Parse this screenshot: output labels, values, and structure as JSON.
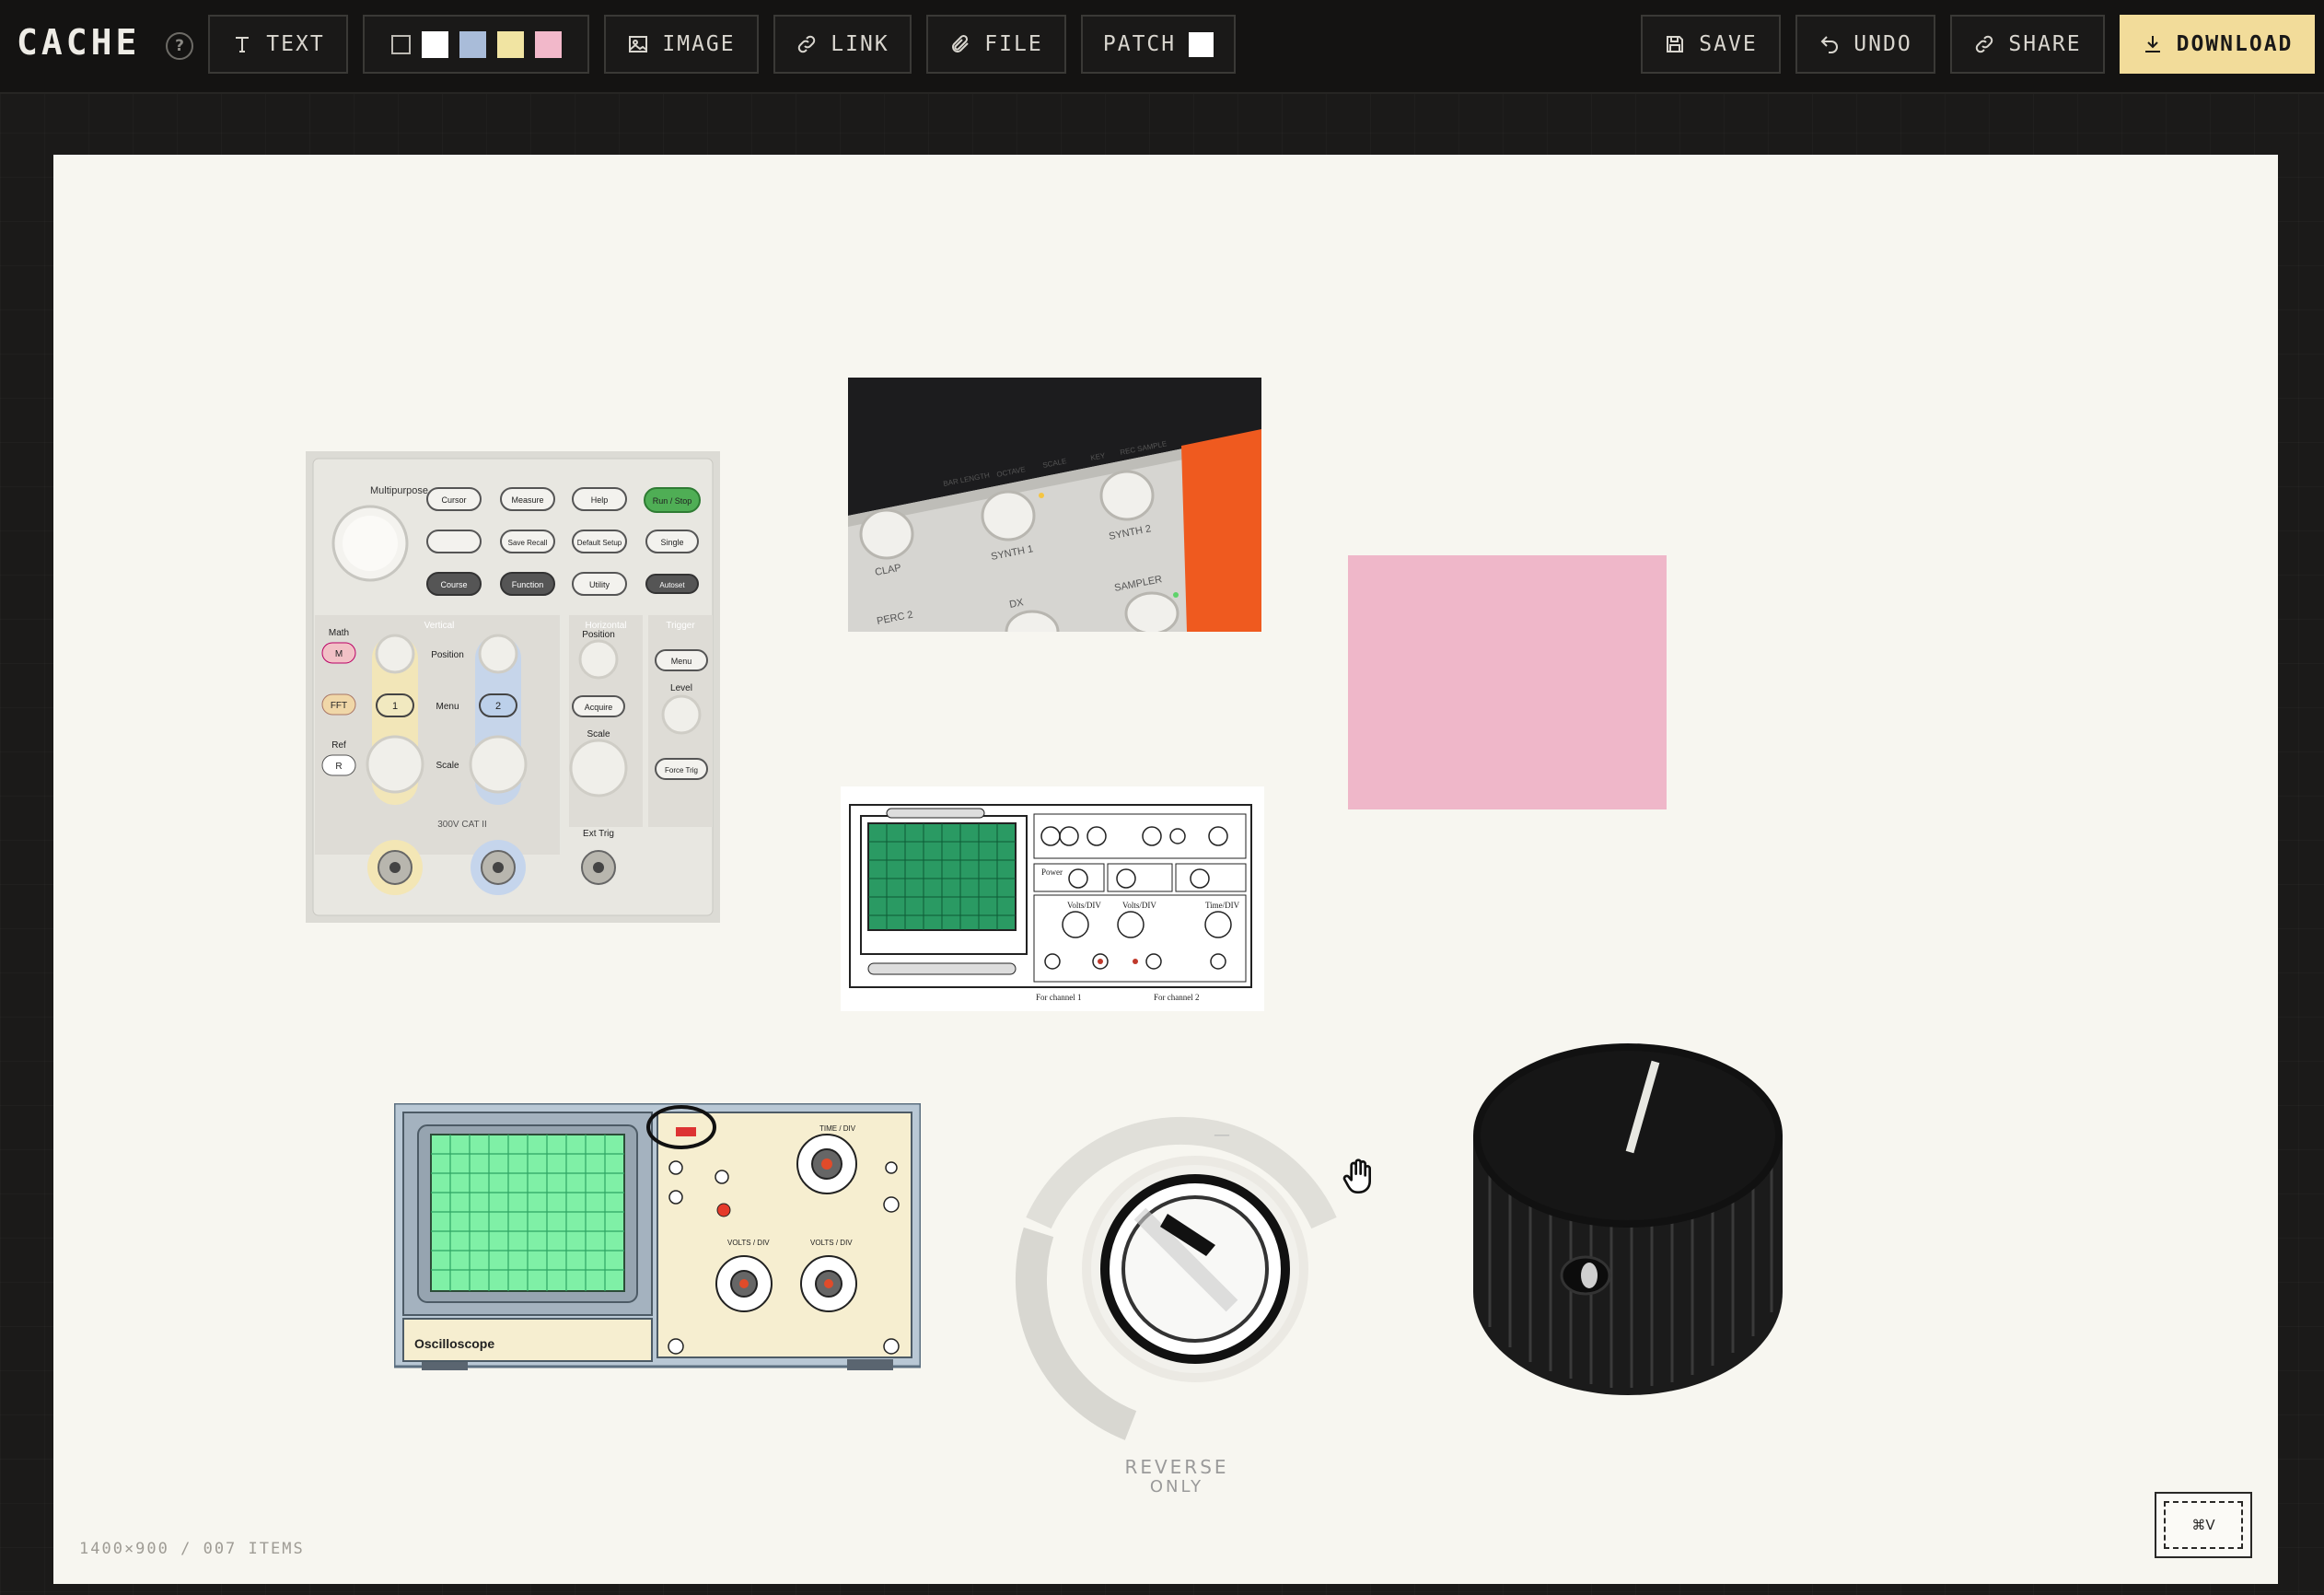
{
  "app": {
    "title": "CACHE",
    "help_glyph": "?"
  },
  "toolbar": {
    "text_label": "TEXT",
    "swatches": [
      "#ffffff",
      "#a9bcd9",
      "#f1e4a2",
      "#f2b8ca"
    ],
    "image_label": "IMAGE",
    "link_label": "LINK",
    "file_label": "FILE",
    "patch_label": "PATCH",
    "patch_color": "#ffffff",
    "save_label": "SAVE",
    "undo_label": "UNDO",
    "share_label": "SHARE",
    "download_label": "DOWNLOAD"
  },
  "canvas": {
    "status": "1400×900 / 007 ITEMS",
    "paste_shortcut": "⌘V",
    "items": [
      {
        "type": "image",
        "name": "digital-oscilloscope-panel"
      },
      {
        "type": "image",
        "name": "synth-knobs-photo"
      },
      {
        "type": "patch",
        "name": "pink-note",
        "color": "#efb7c9"
      },
      {
        "type": "image",
        "name": "oscilloscope-diagram"
      },
      {
        "type": "image",
        "name": "analog-oscilloscope-illustration"
      },
      {
        "type": "image",
        "name": "reverse-knob-photo"
      },
      {
        "type": "image",
        "name": "black-knob-photo"
      }
    ]
  },
  "scope_panel": {
    "multipurpose": "Multipurpose",
    "buttons_row1": [
      "Cursor",
      "Measure",
      "Help",
      "Run / Stop"
    ],
    "buttons_row2": [
      "",
      "Save Recall",
      "Default Setup",
      "Single"
    ],
    "buttons_row3": [
      "Course",
      "Function",
      "Utility",
      "Autoset"
    ],
    "vertical": "Vertical",
    "horizontal": "Horizontal",
    "trigger": "Trigger",
    "math": "Math",
    "m": "M",
    "fft": "FFT",
    "ref": "Ref",
    "r": "R",
    "position": "Position",
    "menu": "Menu",
    "scale": "Scale",
    "ch1": "1",
    "ch2": "2",
    "acquire": "Acquire",
    "level": "Level",
    "force_trig": "Force Trig",
    "ext_trig": "Ext Trig",
    "cat": "300V CAT II"
  },
  "synth_photo": {
    "labels": [
      "BAR LENGTH",
      "OCTAVE",
      "SCALE",
      "KEY",
      "REC SAMPLE",
      "CLAP",
      "SYNTH 1",
      "SYNTH 2",
      "PERC 2",
      "DX",
      "SAMPLER"
    ]
  },
  "diagram": {
    "for_ch1": "For channel 1",
    "for_ch2": "For channel 2",
    "time_div": "Time/DIV",
    "volts_div": "Volts/DIV",
    "power": "Power"
  },
  "analog_scope": {
    "brand": "Oscilloscope",
    "time_div": "TIME / DIV",
    "volts_div": "VOLTS / DIV"
  },
  "reverse_knob": {
    "caption1": "REVERSE",
    "caption2": "ONLY"
  }
}
